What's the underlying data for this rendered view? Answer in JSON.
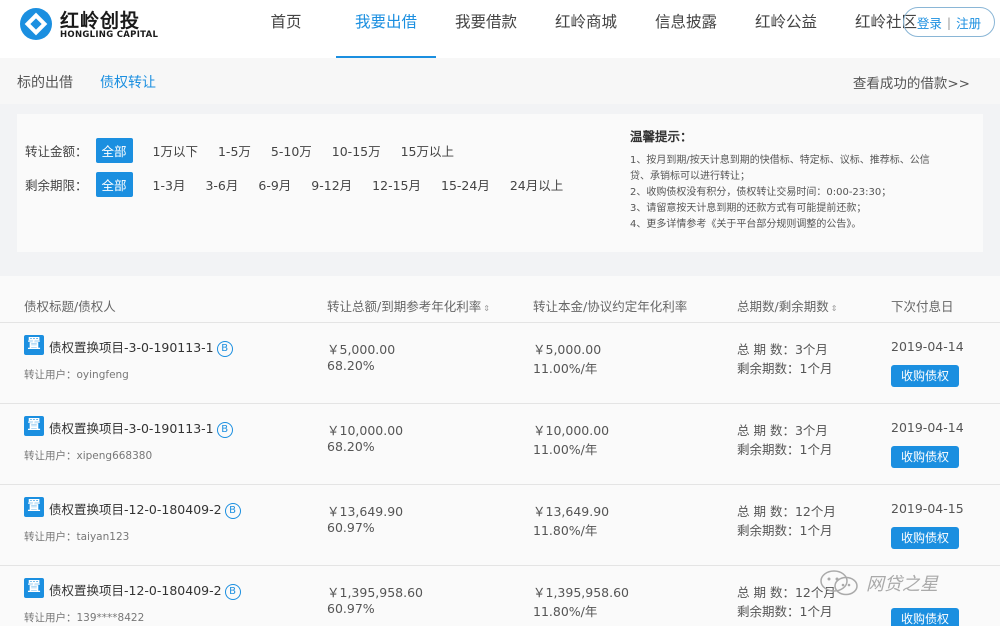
{
  "header": {
    "logo_cn": "红岭创投",
    "logo_en": "HONGLING CAPITAL",
    "nav": [
      "首页",
      "我要出借",
      "我要借款",
      "红岭商城",
      "信息披露",
      "红岭公益",
      "红岭社区"
    ],
    "active_nav": 1,
    "login": "登录",
    "sep": "|",
    "register": "注册"
  },
  "subbar": {
    "tabs": [
      "标的出借",
      "债权转让"
    ],
    "active_tab": 1,
    "success_link": "查看成功的借款>>"
  },
  "filters": {
    "amount_label": "转让金额：",
    "amount_options": [
      "全部",
      "1万以下",
      "1-5万",
      "5-10万",
      "10-15万",
      "15万以上"
    ],
    "term_label": "剩余期限：",
    "term_options": [
      "全部",
      "1-3月",
      "3-6月",
      "6-9月",
      "9-12月",
      "12-15月",
      "15-24月",
      "24月以上"
    ]
  },
  "tips": {
    "title": "温馨提示：",
    "items": [
      "1、按月到期/按天计息到期的快借标、特定标、议标、推荐标、公信",
      "贷、承销标可以进行转让；",
      "2、收购债权没有积分，债权转让交易时间：0:00-23:30；",
      "3、请留意按天计息到期的还款方式有可能提前还款；",
      "4、更多详情参考《关于平台部分规则调整的公告》。"
    ]
  },
  "table": {
    "headers": {
      "title": "债权标题/债权人",
      "total": "转让总额/到期参考年化利率",
      "principal": "转让本金/协议约定年化利率",
      "periods": "总期数/剩余期数",
      "next_date": "下次付息日"
    },
    "sort_glyph": "⇕",
    "rows": [
      {
        "tag": "置",
        "title": "债权置换项目-3-0-190113-1",
        "badge": "B",
        "user": "转让用户：oyingfeng",
        "total": "￥5,000.00",
        "rate": "68.20%",
        "principal": "￥5,000.00",
        "agreed_rate": "11.00%/年",
        "total_periods": "总 期 数：3个月",
        "remaining": "剩余期数：1个月",
        "date": "2019-04-14",
        "button": "收购债权"
      },
      {
        "tag": "置",
        "title": "债权置换项目-3-0-190113-1",
        "badge": "B",
        "user": "转让用户：xipeng668380",
        "total": "￥10,000.00",
        "rate": "68.20%",
        "principal": "￥10,000.00",
        "agreed_rate": "11.00%/年",
        "total_periods": "总 期 数：3个月",
        "remaining": "剩余期数：1个月",
        "date": "2019-04-14",
        "button": "收购债权"
      },
      {
        "tag": "置",
        "title": "债权置换项目-12-0-180409-2",
        "badge": "B",
        "user": "转让用户：taiyan123",
        "total": "￥13,649.90",
        "rate": "60.97%",
        "principal": "￥13,649.90",
        "agreed_rate": "11.80%/年",
        "total_periods": "总 期 数：12个月",
        "remaining": "剩余期数：1个月",
        "date": "2019-04-15",
        "button": "收购债权"
      },
      {
        "tag": "置",
        "title": "债权置换项目-12-0-180409-2",
        "badge": "B",
        "user": "转让用户：139****8422",
        "total": "￥1,395,958.60",
        "rate": "60.97%",
        "principal": "￥1,395,958.60",
        "agreed_rate": "11.80%/年",
        "total_periods": "总 期 数：12个月",
        "remaining": "剩余期数：1个月",
        "date": "",
        "button": "收购债权"
      }
    ]
  },
  "watermark": {
    "text": "网贷之星"
  },
  "colors": {
    "accent": "#1b8fe0"
  }
}
